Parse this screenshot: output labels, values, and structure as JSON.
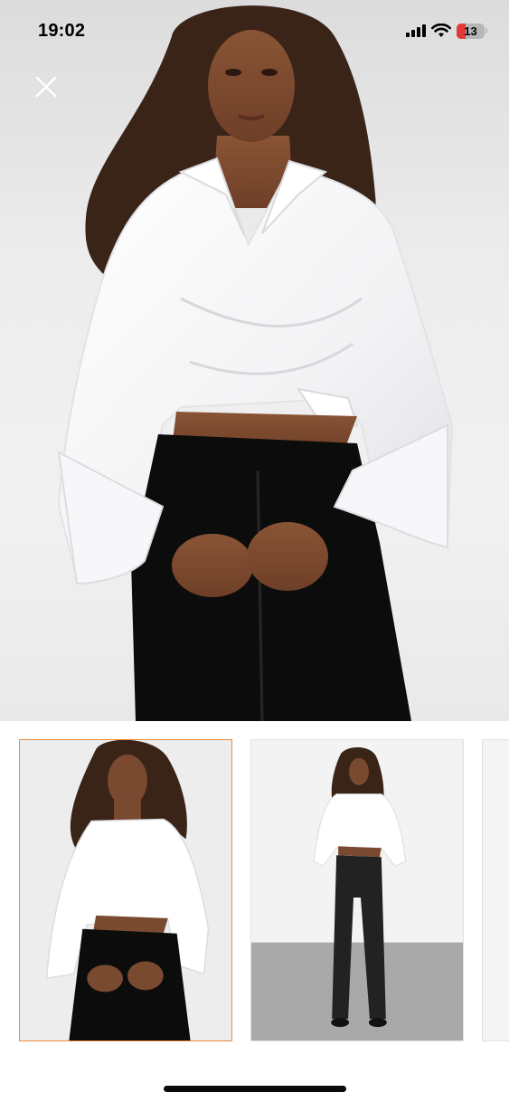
{
  "status_bar": {
    "time": "19:02",
    "battery_level": "13",
    "battery_color": "#e5383b",
    "signal_icon": "cellular-signal-icon",
    "wifi_icon": "wifi-icon"
  },
  "close": {
    "icon": "close-icon"
  },
  "gallery": {
    "selected_index": 0,
    "selected_border_color": "#f08a3a",
    "thumbnail_count_visible": 3
  }
}
